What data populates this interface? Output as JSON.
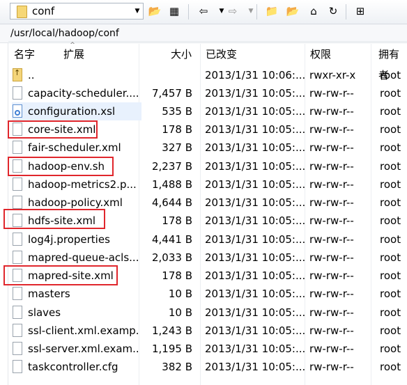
{
  "toolbar": {
    "path_value": "conf",
    "icons": [
      "folder-icon",
      "open-folder-icon",
      "filter-icon",
      "back-arrow-icon",
      "forward-arrow-icon",
      "up-folder-icon",
      "folder-icon",
      "home-icon",
      "refresh-icon",
      "tree-icon"
    ]
  },
  "address": "/usr/local/hadoop/conf",
  "columns": {
    "name": "名字",
    "ext": "扩展",
    "size": "大小",
    "modified": "已改变",
    "permissions": "权限",
    "owner": "拥有者"
  },
  "rows": [
    {
      "name": "..",
      "size": "",
      "date": "2013/1/31 10:06:...",
      "perm": "rwxr-xr-x",
      "owner": "root",
      "icon": "parent-folder-icon"
    },
    {
      "name": "capacity-scheduler....",
      "size": "7,457 B",
      "date": "2013/1/31 10:05:...",
      "perm": "rw-rw-r--",
      "owner": "root",
      "icon": "file-icon"
    },
    {
      "name": "configuration.xsl",
      "size": "535 B",
      "date": "2013/1/31 10:05:...",
      "perm": "rw-rw-r--",
      "owner": "root",
      "icon": "xsl-file-icon"
    },
    {
      "name": "core-site.xml",
      "size": "178 B",
      "date": "2013/1/31 10:05:...",
      "perm": "rw-rw-r--",
      "owner": "root",
      "icon": "file-icon"
    },
    {
      "name": "fair-scheduler.xml",
      "size": "327 B",
      "date": "2013/1/31 10:05:...",
      "perm": "rw-rw-r--",
      "owner": "root",
      "icon": "file-icon"
    },
    {
      "name": "hadoop-env.sh",
      "size": "2,237 B",
      "date": "2013/1/31 10:05:...",
      "perm": "rw-rw-r--",
      "owner": "root",
      "icon": "file-icon"
    },
    {
      "name": "hadoop-metrics2.p...",
      "size": "1,488 B",
      "date": "2013/1/31 10:05:...",
      "perm": "rw-rw-r--",
      "owner": "root",
      "icon": "file-icon"
    },
    {
      "name": "hadoop-policy.xml",
      "size": "4,644 B",
      "date": "2013/1/31 10:05:...",
      "perm": "rw-rw-r--",
      "owner": "root",
      "icon": "file-icon"
    },
    {
      "name": "hdfs-site.xml",
      "size": "178 B",
      "date": "2013/1/31 10:05:...",
      "perm": "rw-rw-r--",
      "owner": "root",
      "icon": "file-icon"
    },
    {
      "name": "log4j.properties",
      "size": "4,441 B",
      "date": "2013/1/31 10:05:...",
      "perm": "rw-rw-r--",
      "owner": "root",
      "icon": "file-icon"
    },
    {
      "name": "mapred-queue-acls...",
      "size": "2,033 B",
      "date": "2013/1/31 10:05:...",
      "perm": "rw-rw-r--",
      "owner": "root",
      "icon": "file-icon"
    },
    {
      "name": "mapred-site.xml",
      "size": "178 B",
      "date": "2013/1/31 10:05:...",
      "perm": "rw-rw-r--",
      "owner": "root",
      "icon": "file-icon"
    },
    {
      "name": "masters",
      "size": "10 B",
      "date": "2013/1/31 10:05:...",
      "perm": "rw-rw-r--",
      "owner": "root",
      "icon": "file-icon"
    },
    {
      "name": "slaves",
      "size": "10 B",
      "date": "2013/1/31 10:05:...",
      "perm": "rw-rw-r--",
      "owner": "root",
      "icon": "file-icon"
    },
    {
      "name": "ssl-client.xml.examp...",
      "size": "1,243 B",
      "date": "2013/1/31 10:05:...",
      "perm": "rw-rw-r--",
      "owner": "root",
      "icon": "file-icon"
    },
    {
      "name": "ssl-server.xml.exam...",
      "size": "1,195 B",
      "date": "2013/1/31 10:05:...",
      "perm": "rw-rw-r--",
      "owner": "root",
      "icon": "file-icon"
    },
    {
      "name": "taskcontroller.cfg",
      "size": "382 B",
      "date": "2013/1/31 10:05:...",
      "perm": "rw-rw-r--",
      "owner": "root",
      "icon": "file-icon"
    }
  ],
  "colors": {
    "highlight": "#e0262c",
    "selected": "#e8f1fd"
  }
}
